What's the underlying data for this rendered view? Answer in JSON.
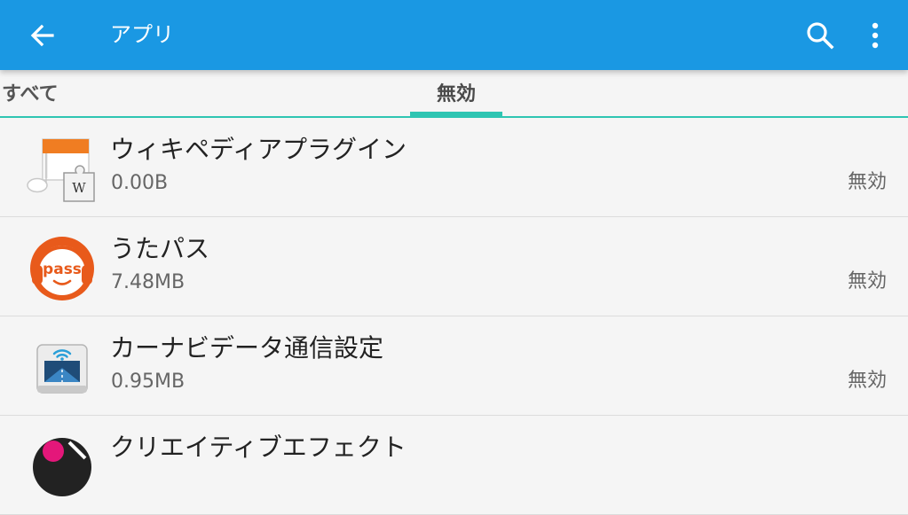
{
  "appbar": {
    "title": "アプリ",
    "back_icon": "arrow-left-icon",
    "search_icon": "search-icon",
    "overflow_icon": "more-vert-icon",
    "color": "#1a98e3"
  },
  "tabs": [
    {
      "label": "すべて",
      "selected": false
    },
    {
      "label": "無効",
      "selected": true
    }
  ],
  "accent_color": "#2ec5b2",
  "apps": [
    {
      "name": "ウィキペディアプラグイン",
      "size": "0.00B",
      "status": "無効",
      "icon": "wikipedia-plugin-icon",
      "icon_badge": "W"
    },
    {
      "name": "うたパス",
      "size": "7.48MB",
      "status": "無効",
      "icon": "utapass-icon",
      "icon_badge": "pass"
    },
    {
      "name": "カーナビデータ通信設定",
      "size": "0.95MB",
      "status": "無効",
      "icon": "car-navi-data-icon"
    },
    {
      "name": "クリエイティブエフェクト",
      "icon": "creative-effect-icon"
    }
  ]
}
